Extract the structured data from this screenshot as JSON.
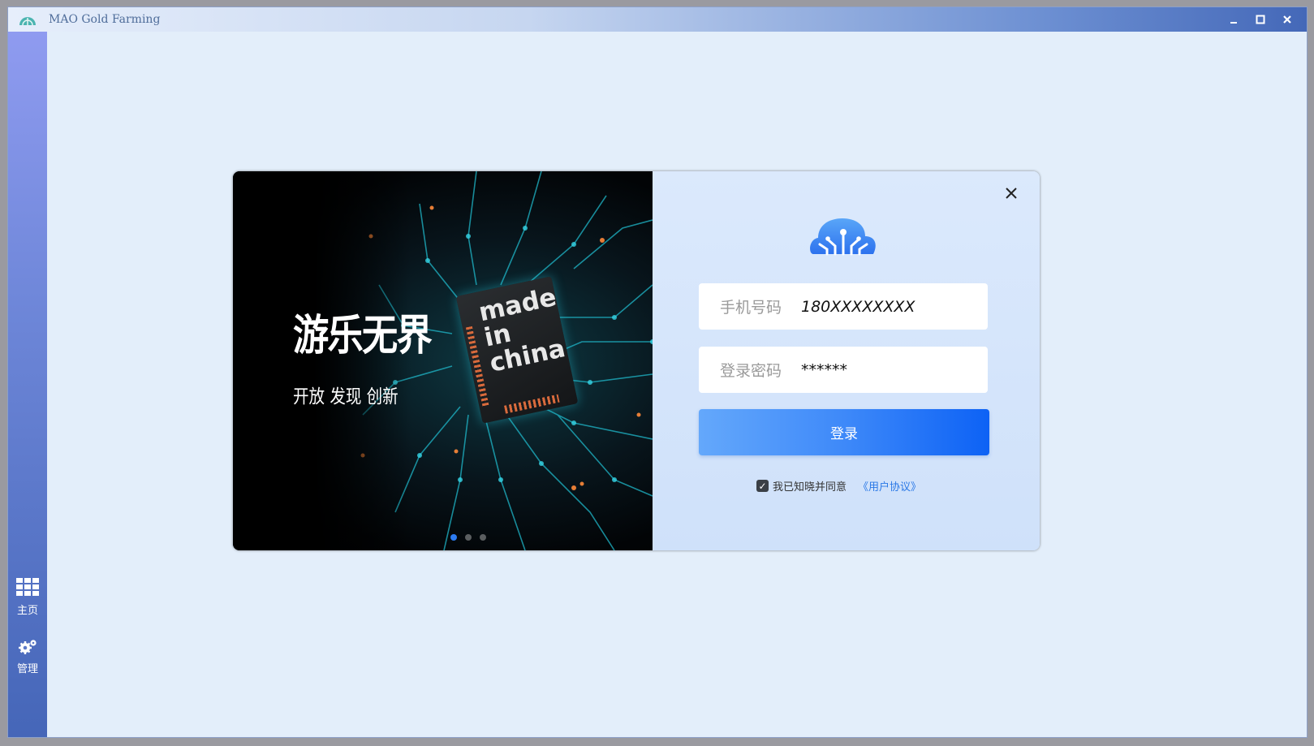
{
  "window": {
    "title": "MAO Gold Farming",
    "controls": {
      "minimize": "‗",
      "maximize": "□",
      "close": "✕"
    }
  },
  "sidebar": {
    "items": [
      {
        "label": "主页",
        "icon": "grid-icon"
      },
      {
        "label": "管理",
        "icon": "gears-icon"
      }
    ]
  },
  "banner": {
    "headline": "游乐无界",
    "subline": "开放 发现 创新",
    "chip_text": [
      "made",
      "in",
      "china"
    ],
    "dots": 3,
    "active_dot": 0
  },
  "login": {
    "close": "✕",
    "phone_label": "手机号码",
    "phone_value": "180XXXXXXXX",
    "password_label": "登录密码",
    "password_value": "******",
    "submit_label": "登录",
    "agree_checked": true,
    "agree_text": "我已知晓并同意",
    "agree_link": "《用户协议》"
  },
  "colors": {
    "accent": "#2d7cf2",
    "button_start": "#64a8fb",
    "button_end": "#0d62f5",
    "sidebar_top": "#8f9bf0",
    "sidebar_bottom": "#4566b8"
  }
}
